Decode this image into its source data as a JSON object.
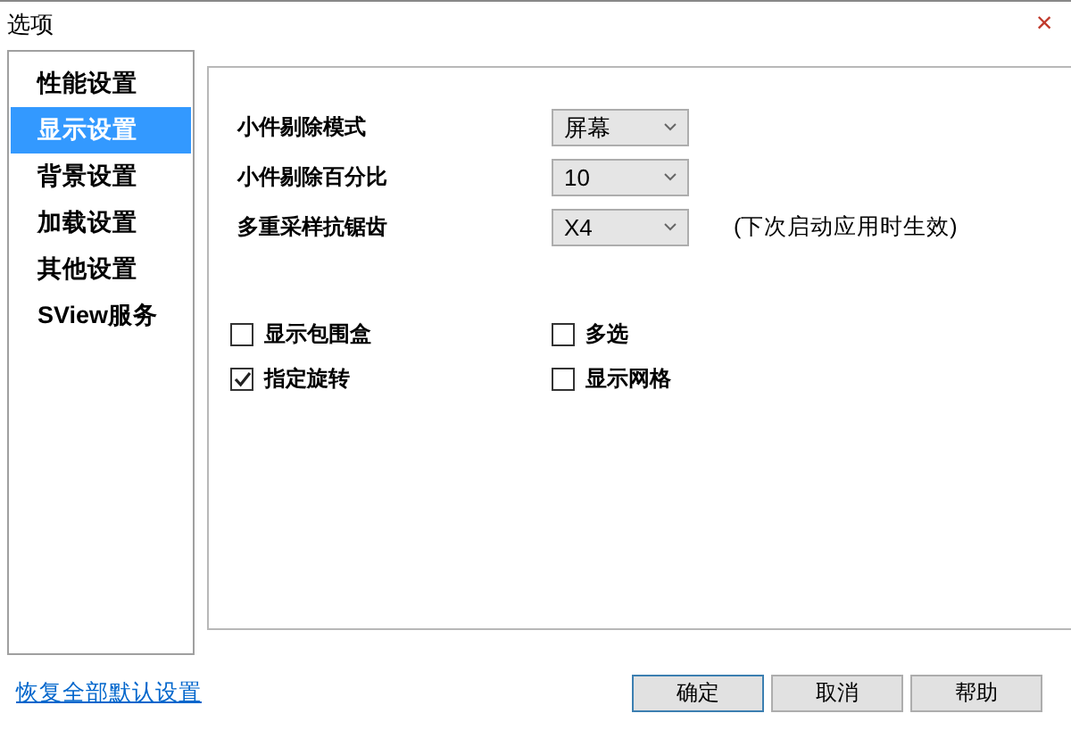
{
  "window": {
    "title": "选项",
    "close": "×"
  },
  "sidebar": {
    "items": [
      {
        "label": "性能设置",
        "selected": false
      },
      {
        "label": "显示设置",
        "selected": true
      },
      {
        "label": "背景设置",
        "selected": false
      },
      {
        "label": "加载设置",
        "selected": false
      },
      {
        "label": "其他设置",
        "selected": false
      },
      {
        "label": "SView服务",
        "selected": false
      }
    ]
  },
  "settings": [
    {
      "label": "小件剔除模式",
      "value": "屏幕"
    },
    {
      "label": "小件剔除百分比",
      "value": "10"
    },
    {
      "label": "多重采样抗锯齿",
      "value": "X4",
      "note": "(下次启动应用时生效)"
    }
  ],
  "checkboxes": [
    {
      "label": "显示包围盒",
      "checked": false
    },
    {
      "label": "多选",
      "checked": false
    },
    {
      "label": "指定旋转",
      "checked": true
    },
    {
      "label": "显示网格",
      "checked": false
    }
  ],
  "reset_link": "恢复全部默认设置",
  "buttons": [
    {
      "label": "确定",
      "selected": true
    },
    {
      "label": "取消",
      "selected": false
    },
    {
      "label": "帮助",
      "selected": false
    }
  ]
}
